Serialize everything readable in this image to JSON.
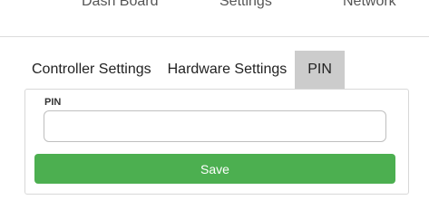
{
  "topnav": {
    "items": [
      {
        "label": "Dash Board"
      },
      {
        "label": "Settings"
      },
      {
        "label": "Network"
      }
    ]
  },
  "tabs": [
    {
      "label": "Controller Settings",
      "active": false
    },
    {
      "label": "Hardware Settings",
      "active": false
    },
    {
      "label": "PIN",
      "active": true
    }
  ],
  "form": {
    "pin_label": "PIN",
    "pin_value": "",
    "pin_placeholder": "",
    "save_label": "Save"
  },
  "colors": {
    "save_button": "#4caf50",
    "active_tab": "#cccccc"
  }
}
